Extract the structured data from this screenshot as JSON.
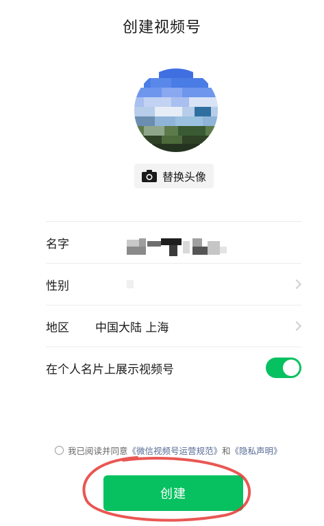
{
  "header": {
    "title": "创建视频号"
  },
  "avatar": {
    "change_label": "替换头像",
    "change_icon": "camera-icon"
  },
  "form": {
    "name": {
      "label": "名字",
      "value": ""
    },
    "gender": {
      "label": "性别",
      "value": ""
    },
    "region": {
      "label": "地区",
      "value": "中国大陆 上海"
    },
    "show_on_card": {
      "label": "在个人名片上展示视频号",
      "enabled": true
    }
  },
  "agreement": {
    "prefix": "我已阅读并同意",
    "doc1": "《微信视频号运营规范》",
    "conjunction": "和",
    "doc2": "《隐私声明》"
  },
  "actions": {
    "create_label": "创建"
  },
  "colors": {
    "accent": "#07c160",
    "link": "#576b95",
    "annotation": "#e53935"
  }
}
